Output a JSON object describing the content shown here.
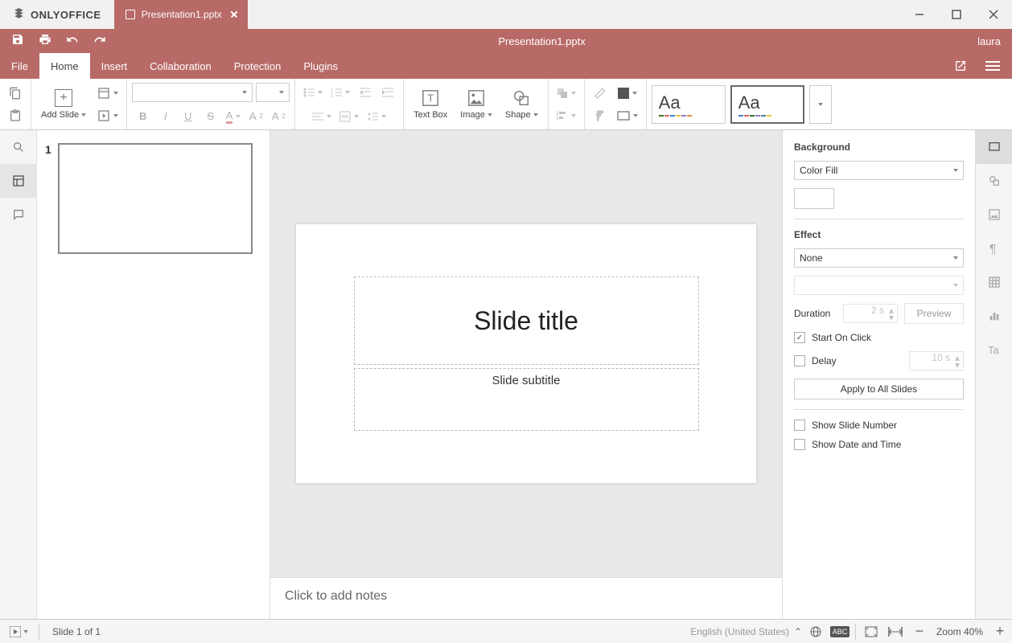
{
  "app": {
    "logo": "ONLYOFFICE",
    "tabName": "Presentation1.pptx",
    "user": "laura",
    "docTitle": "Presentation1.pptx"
  },
  "menu": {
    "items": [
      "File",
      "Home",
      "Insert",
      "Collaboration",
      "Protection",
      "Plugins"
    ],
    "activeIndex": 1
  },
  "ribbon": {
    "addSlide": "Add Slide",
    "textBox": "Text Box",
    "image": "Image",
    "shape": "Shape"
  },
  "thumbs": {
    "num1": "1"
  },
  "slide": {
    "title": "Slide title",
    "subtitle": "Slide subtitle"
  },
  "notes": {
    "placeholder": "Click to add notes"
  },
  "panel": {
    "bgLabel": "Background",
    "bgFill": "Color Fill",
    "effectLabel": "Effect",
    "effectVal": "None",
    "durationLabel": "Duration",
    "durationVal": "2 s",
    "previewBtn": "Preview",
    "startOnClick": "Start On Click",
    "delayLabel": "Delay",
    "delayVal": "10 s",
    "applyAll": "Apply to All Slides",
    "showNum": "Show Slide Number",
    "showDate": "Show Date and Time"
  },
  "status": {
    "slideCount": "Slide 1 of 1",
    "lang": "English (United States)",
    "zoom": "Zoom 40%"
  }
}
